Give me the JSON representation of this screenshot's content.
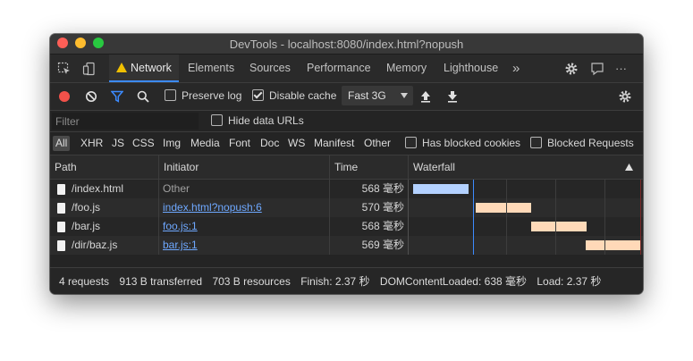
{
  "window": {
    "title": "DevTools - localhost:8080/index.html?nopush"
  },
  "tabs": [
    {
      "label": "Network",
      "active": true,
      "icon": "warning-icon"
    },
    {
      "label": "Elements"
    },
    {
      "label": "Sources"
    },
    {
      "label": "Performance"
    },
    {
      "label": "Memory"
    },
    {
      "label": "Lighthouse"
    }
  ],
  "tabbar": {
    "more_label": "»",
    "overflow_label": "···"
  },
  "toolbar": {
    "preserve_log_label": "Preserve log",
    "preserve_log_checked": false,
    "disable_cache_label": "Disable cache",
    "disable_cache_checked": true,
    "throttle_value": "Fast 3G"
  },
  "filter": {
    "placeholder": "Filter",
    "hide_data_urls_label": "Hide data URLs",
    "hide_data_urls_checked": false
  },
  "types": [
    "All",
    "XHR",
    "JS",
    "CSS",
    "Img",
    "Media",
    "Font",
    "Doc",
    "WS",
    "Manifest",
    "Other"
  ],
  "blocked": {
    "blocked_cookies_label": "Has blocked cookies",
    "blocked_requests_label": "Blocked Requests"
  },
  "columns": {
    "path": "Path",
    "initiator": "Initiator",
    "time": "Time",
    "waterfall": "Waterfall"
  },
  "requests": [
    {
      "path": "/index.html",
      "initiator": "Other",
      "initiator_link": false,
      "time": "568 毫秒",
      "bar_color": "#b3d1ff"
    },
    {
      "path": "/foo.js",
      "initiator": "index.html?nopush:6",
      "initiator_link": true,
      "time": "570 毫秒",
      "bar_color": "#ffd9b8"
    },
    {
      "path": "/bar.js",
      "initiator": "foo.js:1",
      "initiator_link": true,
      "time": "568 毫秒",
      "bar_color": "#ffd9b8"
    },
    {
      "path": "/dir/baz.js",
      "initiator": "bar.js:1",
      "initiator_link": true,
      "time": "569 毫秒",
      "bar_color": "#ffd9b8"
    }
  ],
  "status": {
    "requests": "4 requests",
    "transferred": "913 B transferred",
    "resources": "703 B resources",
    "finish": "Finish: 2.37 秒",
    "dcl": "DOMContentLoaded: 638 毫秒",
    "load": "Load: 2.37 秒"
  },
  "colors": {
    "accent": "#3c8bff",
    "link": "#6ea8ff",
    "record": "#f2514a"
  }
}
